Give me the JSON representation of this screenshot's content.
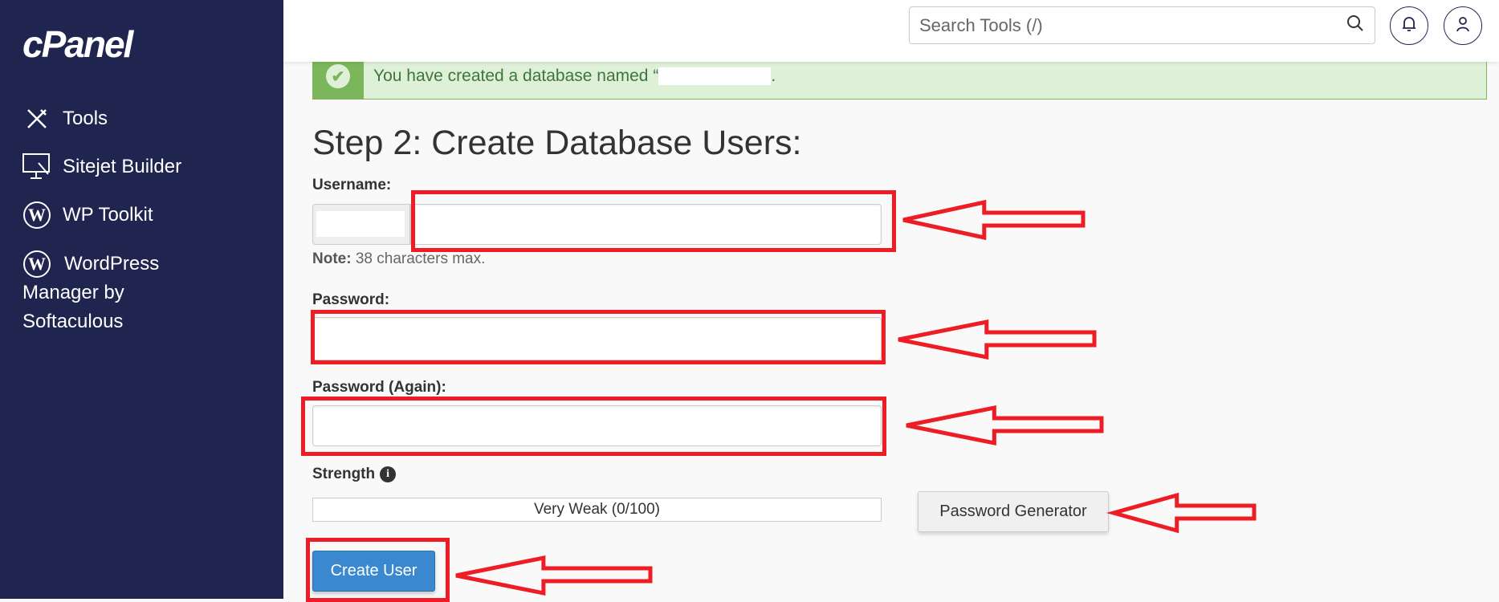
{
  "sidebar": {
    "logo": "cPanel",
    "items": [
      {
        "label": "Tools",
        "icon": "tools-icon"
      },
      {
        "label": "Sitejet Builder",
        "icon": "monitor-pen-icon"
      },
      {
        "label": "WP Toolkit",
        "icon": "wordpress-icon"
      },
      {
        "label": "WordPress Manager by Softaculous",
        "icon": "wordpress-icon"
      }
    ]
  },
  "header": {
    "search_placeholder": "Search Tools (/)",
    "icons": [
      "search-icon",
      "bell-icon",
      "user-icon"
    ]
  },
  "alert": {
    "message": "You have created a database named “",
    "suffix": ".",
    "icon": "check-circle-icon",
    "color": "#7cb65a"
  },
  "main": {
    "title": "Step 2: Create Database Users:",
    "username_label": "Username:",
    "username_value": "",
    "note_bold": "Note:",
    "note_text": " 38 characters max.",
    "password_label": "Password:",
    "password_value": "",
    "password_again_label": "Password (Again):",
    "password_again_value": "",
    "strength_label": "Strength",
    "strength_value": "Very Weak (0/100)",
    "strength_percent": 0,
    "password_generator_label": "Password Generator",
    "create_user_label": "Create User"
  },
  "colors": {
    "sidebar": "#20254f",
    "primary_button": "#3a89d0",
    "annotation": "#ee1c24"
  }
}
